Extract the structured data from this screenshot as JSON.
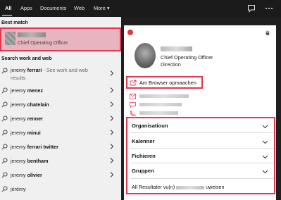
{
  "topbar": {
    "tabs": [
      {
        "label": "All"
      },
      {
        "label": "Apps"
      },
      {
        "label": "Documents"
      },
      {
        "label": "Web"
      },
      {
        "label": "More"
      }
    ],
    "more_caret": "▾"
  },
  "left": {
    "best_match_label": "Best match",
    "best_match_subtitle": "Chief Operating Officer",
    "search_web_label": "Search work and web",
    "suggestions": [
      {
        "prefix": "jeremy ",
        "bold": "ferrari",
        "hint": " - See work and web results"
      },
      {
        "prefix": "jeremy ",
        "bold": "menez",
        "hint": ""
      },
      {
        "prefix": "jeremy ",
        "bold": "chatelain",
        "hint": ""
      },
      {
        "prefix": "jeremy ",
        "bold": "renner",
        "hint": ""
      },
      {
        "prefix": "jeremy ",
        "bold": "minui",
        "hint": ""
      },
      {
        "prefix": "jeremy ",
        "bold": "ferrari twitter",
        "hint": ""
      },
      {
        "prefix": "jeremy ",
        "bold": "bentham",
        "hint": ""
      },
      {
        "prefix": "jeremy ",
        "bold": "olivier",
        "hint": ""
      },
      {
        "prefix": "jérémy",
        "bold": "",
        "hint": ""
      }
    ]
  },
  "card": {
    "person_title": "Chief Operating Officer",
    "person_dept": "Direction",
    "browser_action": "Am Browser opmaachen",
    "sections": [
      "Organisatioun",
      "Kalenner",
      "Fichieren",
      "Gruppen"
    ],
    "all_results_prefix": "All Resultater vu(n)",
    "all_results_suffix": "uweisen"
  },
  "colors": {
    "highlight_border": "#e0394e",
    "best_match_bg": "#e8b4c0",
    "accent_underline": "#5ea0ef"
  }
}
